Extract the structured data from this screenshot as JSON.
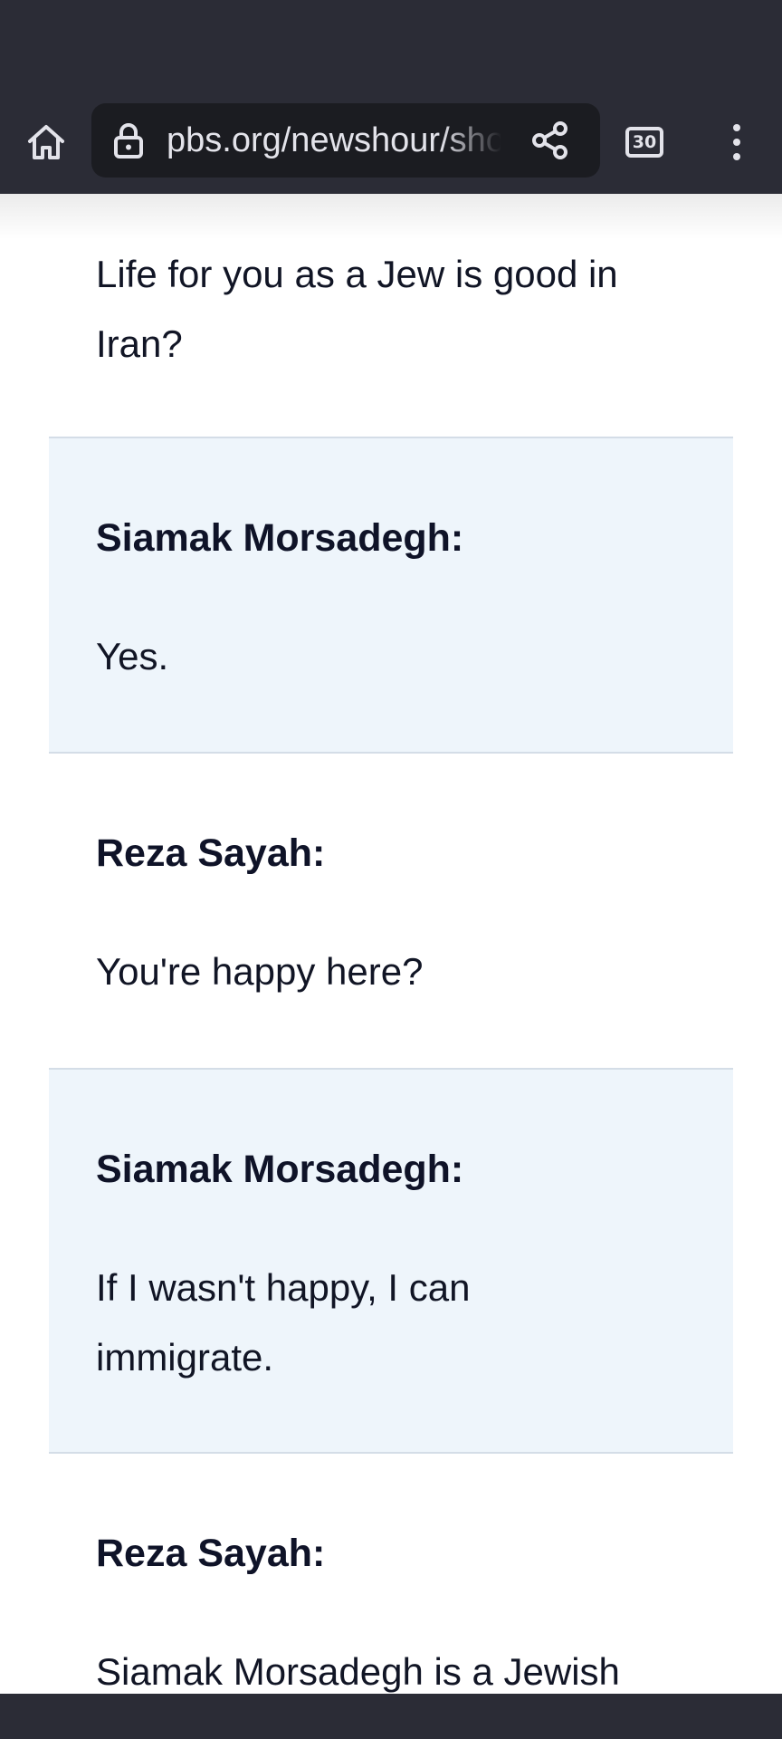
{
  "browser": {
    "url": "pbs.org/newshour/show",
    "tab_count": "30",
    "icons": {
      "home": "home-icon",
      "lock": "lock-icon",
      "share": "share-icon",
      "tabs": "tab-switcher-icon",
      "menu": "more-vert-icon"
    }
  },
  "transcript": {
    "intro_text": "Life for you as a Jew is good in Iran?",
    "entries": [
      {
        "speaker": "Siamak Morsadegh:",
        "text": "Yes."
      },
      {
        "speaker": "Reza Sayah:",
        "text": "You're happy here?"
      },
      {
        "speaker": "Siamak Morsadegh:",
        "text": "If I wasn't happy, I can immigrate."
      },
      {
        "speaker": "Reza Sayah:",
        "text": "Siamak Morsadegh is a Jewish"
      }
    ]
  },
  "colors": {
    "chrome_bg": "#2b2c36",
    "omnibox_bg": "#1b1c21",
    "highlight_band": "#eef5fb",
    "band_border": "#d4dde7",
    "text": "#111525"
  }
}
